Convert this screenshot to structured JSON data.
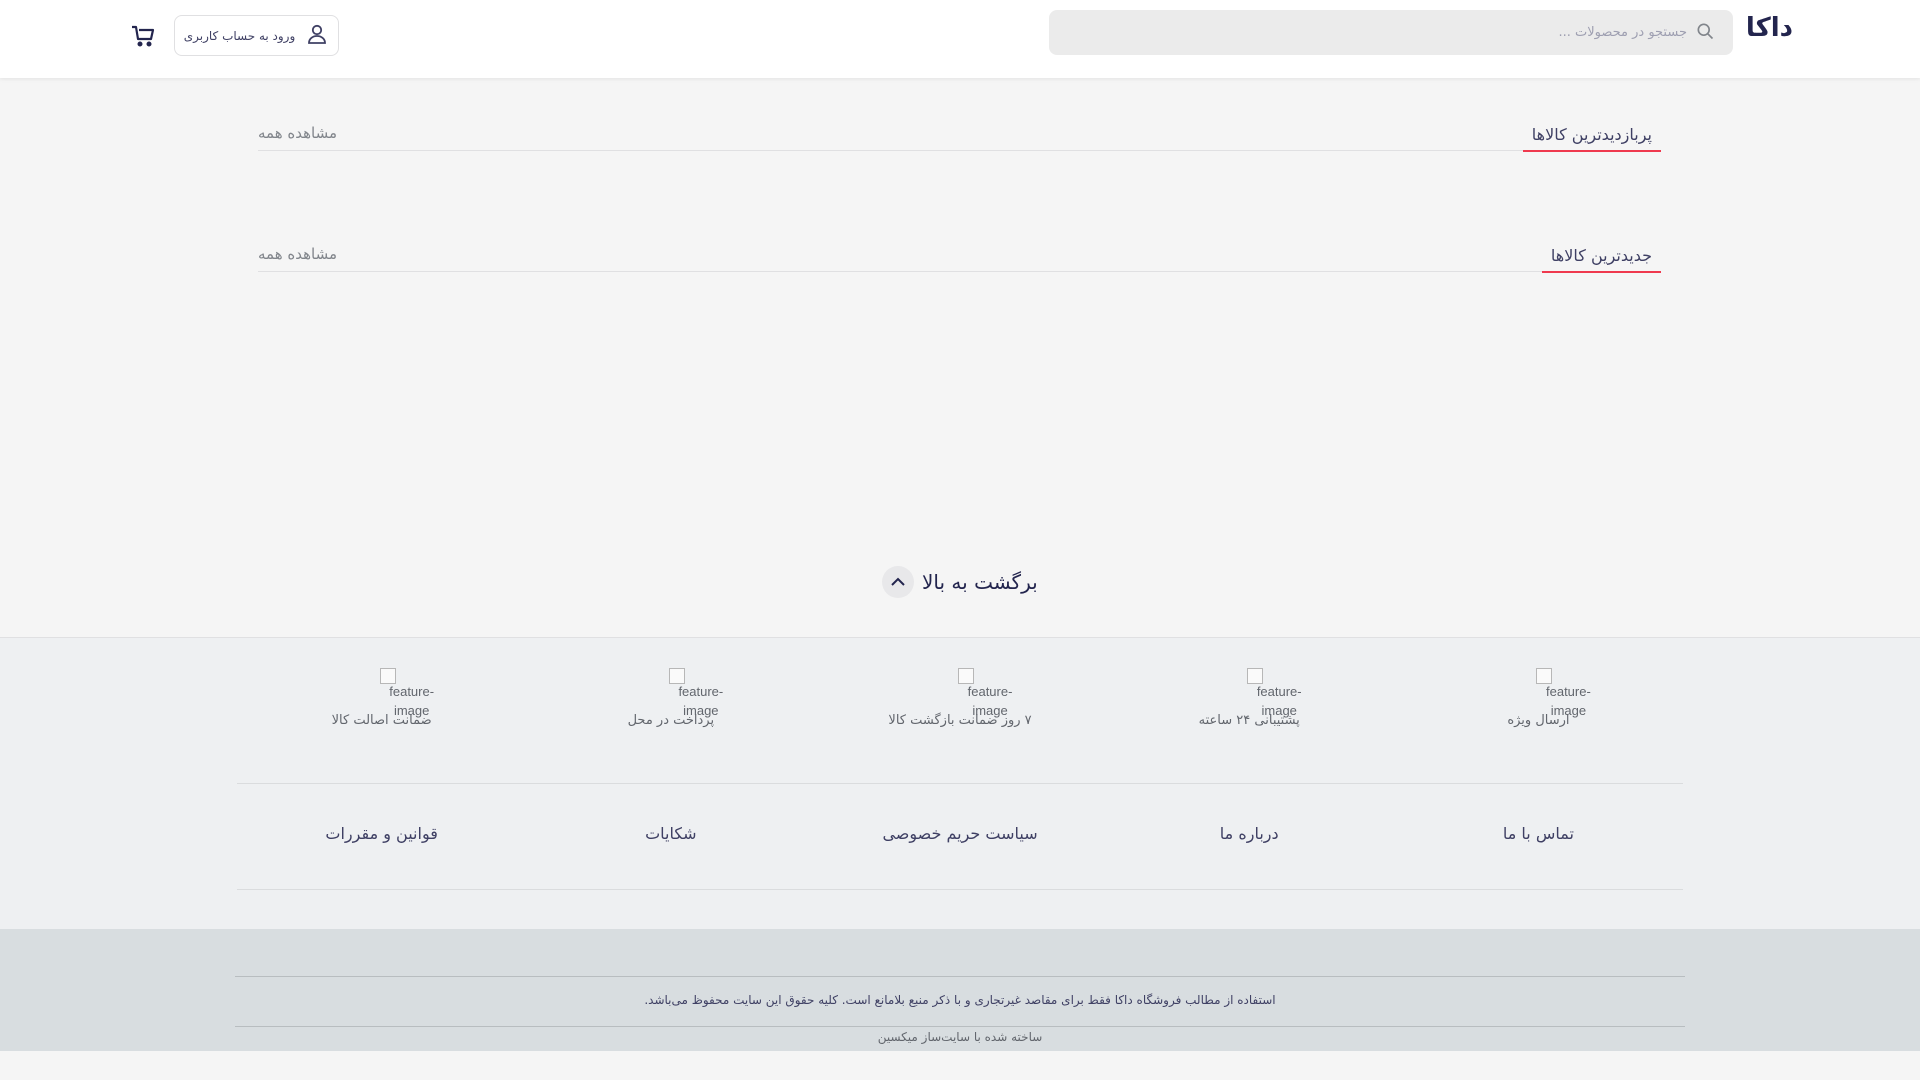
{
  "header": {
    "logo": "داکا",
    "search_placeholder": "جستجو در محصولات ...",
    "login_label": "ورود به حساب کاربری"
  },
  "sections": [
    {
      "title": "پربازدیدترین کالاها",
      "view_all": "مشاهده همه"
    },
    {
      "title": "جدیدترین کالاها",
      "view_all": "مشاهده همه"
    }
  ],
  "back_to_top": "برگشت به بالا",
  "features": [
    {
      "alt": "feature-image",
      "label": "ارسال ویژه"
    },
    {
      "alt": "feature-image",
      "label": "پشتیبانی ۲۴ ساعته"
    },
    {
      "alt": "feature-image",
      "label": "۷ روز ضمانت بازگشت کالا"
    },
    {
      "alt": "feature-image",
      "label": "پرداخت در محل"
    },
    {
      "alt": "feature-image",
      "label": "ضمانت اصالت کالا"
    }
  ],
  "footer_links": [
    "تماس با ما",
    "درباره ما",
    "سیاست حریم خصوصی",
    "شکایات",
    "قوانین و مقررات"
  ],
  "copyright": "استفاده از مطالب فروشگاه داکا فقط برای مقاصد غیرتجاری و با ذکر منبع بلامانع است. کلیه حقوق این سایت محفوظ می‌باشد.",
  "builder": "ساخته شده با سایت‌ساز میکسین",
  "colors": {
    "accent": "#ef394e",
    "page_bg": "#f5f5f5",
    "footer_band": "#eef0f2",
    "copyright_band": "#d8dde0"
  }
}
